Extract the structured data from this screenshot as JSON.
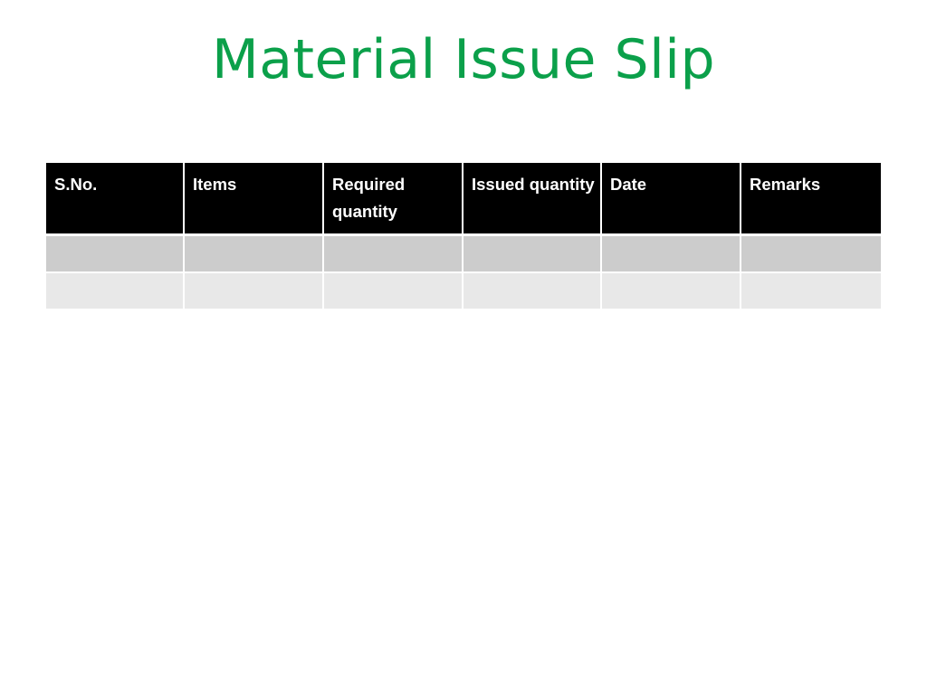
{
  "slide": {
    "title": "Material Issue Slip",
    "title_color": "#0BA04A",
    "background_color": "#FFFFFF"
  },
  "table": {
    "header_background": "#000000",
    "header_text_color": "#FFFFFF",
    "row_band_a_color": "#CCCCCC",
    "row_band_b_color": "#E8E8E8",
    "columns": [
      {
        "label": "S.No."
      },
      {
        "label": "Items"
      },
      {
        "label": "Required quantity"
      },
      {
        "label": "Issued quantity"
      },
      {
        "label": "Date"
      },
      {
        "label": "Remarks"
      }
    ],
    "rows": [
      {
        "cells": [
          "",
          "",
          "",
          "",
          "",
          ""
        ]
      },
      {
        "cells": [
          "",
          "",
          "",
          "",
          "",
          ""
        ]
      }
    ]
  }
}
